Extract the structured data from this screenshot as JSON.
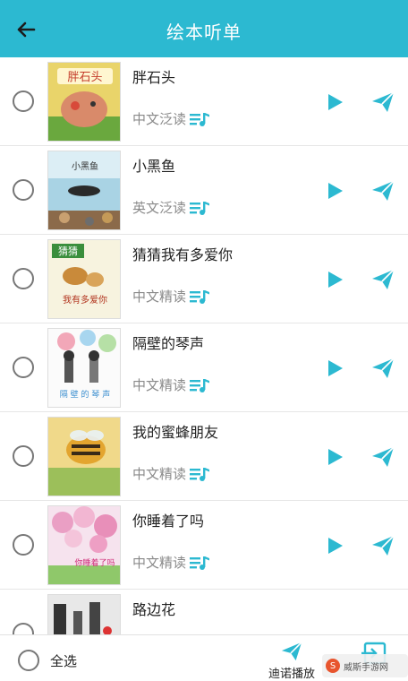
{
  "header": {
    "title": "绘本听单"
  },
  "books": [
    {
      "title": "胖石头",
      "tag": "中文泛读",
      "cover_title": "胖石头"
    },
    {
      "title": "小黑鱼",
      "tag": "英文泛读",
      "cover_title": "小黑鱼"
    },
    {
      "title": "猜猜我有多爱你",
      "tag": "中文精读",
      "cover_title": "猜猜 我有多爱你"
    },
    {
      "title": "隔壁的琴声",
      "tag": "中文精读",
      "cover_title": "隔 壁 的 琴 声"
    },
    {
      "title": "我的蜜蜂朋友",
      "tag": "中文精读",
      "cover_title": ""
    },
    {
      "title": "你睡着了吗",
      "tag": "中文精读",
      "cover_title": "你睡着了吗"
    },
    {
      "title": "路边花",
      "tag": "",
      "cover_title": ""
    }
  ],
  "bottom": {
    "select_all": "全选",
    "continuous_play": "迪诺播放"
  },
  "watermark": {
    "text": "威斯手游网"
  },
  "colors": {
    "accent": "#2cb9d1"
  }
}
